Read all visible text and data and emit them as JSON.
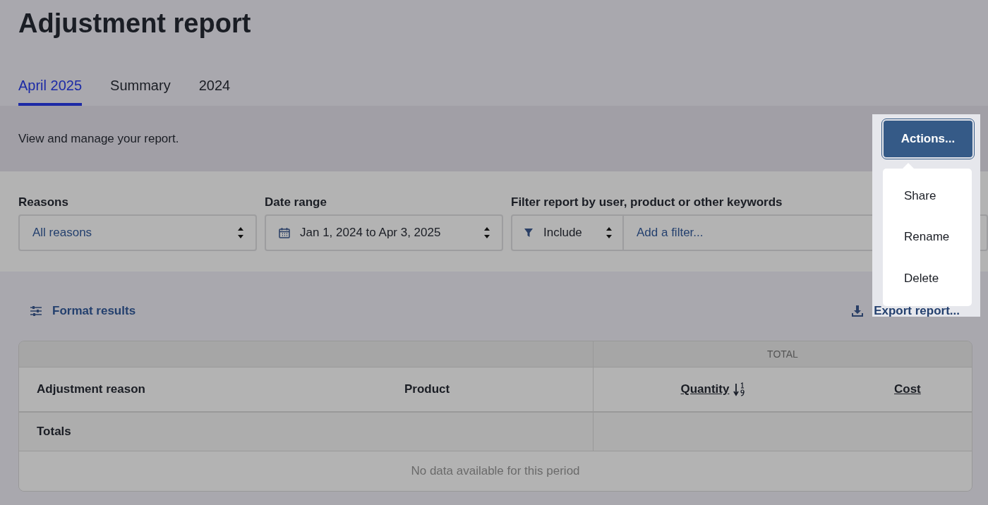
{
  "title": "Adjustment report",
  "tabs": [
    {
      "label": "April 2025",
      "selected": true
    },
    {
      "label": "Summary",
      "selected": false
    },
    {
      "label": "2024",
      "selected": false
    }
  ],
  "description": "View and manage your report.",
  "actions_button": "Actions...",
  "actions_menu": [
    "Share",
    "Rename",
    "Delete"
  ],
  "filters": {
    "reasons": {
      "label": "Reasons",
      "value": "All reasons"
    },
    "date_range": {
      "label": "Date range",
      "value": "Jan 1, 2024 to Apr 3, 2025"
    },
    "keyword_filter": {
      "label": "Filter report by user, product or other keywords",
      "mode": "Include",
      "placeholder": "Add a filter..."
    }
  },
  "toolbar": {
    "format_results": "Format results",
    "export_report": "Export report..."
  },
  "table": {
    "group_header": "TOTAL",
    "columns": [
      {
        "label": "Adjustment reason",
        "kind": "plain",
        "sorted": false
      },
      {
        "label": "Product",
        "kind": "plain",
        "sorted": false
      },
      {
        "label": "Quantity",
        "kind": "sortable",
        "sorted": true
      },
      {
        "label": "Cost",
        "kind": "sortable",
        "sorted": false
      }
    ],
    "totals_label": "Totals",
    "empty_message": "No data available for this period"
  }
}
